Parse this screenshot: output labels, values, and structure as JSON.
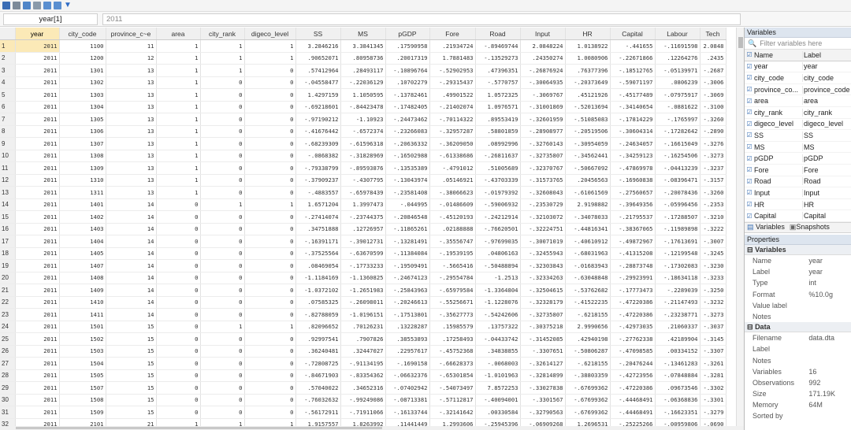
{
  "toolbar": {
    "icons": [
      "save-icon",
      "print-icon",
      "copy-icon",
      "paste-icon",
      "edit-icon",
      "browse-icon",
      "filter-icon"
    ]
  },
  "cellbar": {
    "name": "year[1]",
    "value": "2011"
  },
  "grid": {
    "columns": [
      "year",
      "city_code",
      "province_c~e",
      "area",
      "city_rank",
      "digeco_level",
      "SS",
      "MS",
      "pGDP",
      "Fore",
      "Road",
      "Input",
      "HR",
      "Capital",
      "Labour",
      "Tech"
    ],
    "rows": [
      [
        "1",
        "2011",
        "1100",
        "11",
        "1",
        "1",
        "1",
        "3.2846216",
        "3.3841345",
        ".17590958",
        ".21934724",
        "-.89469744",
        "2.0848224",
        "1.0138922",
        "-.441655",
        "-.11691598",
        "2.0848"
      ],
      [
        "2",
        "2011",
        "1200",
        "12",
        "1",
        "1",
        "1",
        ".90652071",
        ".80958736",
        ".20017319",
        "1.7881483",
        "-.13529273",
        ".24350274",
        "1.0080906",
        "-.22671866",
        ".12264276",
        ".2435"
      ],
      [
        "3",
        "2011",
        "1301",
        "13",
        "1",
        "1",
        "0",
        ".57412964",
        ".28493117",
        "-.10896764",
        "-.52902953",
        ".47396351",
        "-.26876924",
        ".76377396",
        "-.18512765",
        "-.05139971",
        "-.2687"
      ],
      [
        "4",
        "2011",
        "1302",
        "13",
        "1",
        "0",
        "0",
        "-.04558477",
        "-.22036129",
        ".10702279",
        "-.29315437",
        "-.5770757",
        "-.30064935",
        "-.20373649",
        "-.59071197",
        ".0806239",
        "-.3006"
      ],
      [
        "5",
        "2011",
        "1303",
        "13",
        "1",
        "0",
        "0",
        "1.4297159",
        "1.1050595",
        "-.13782461",
        ".49901522",
        "1.0572325",
        "-.3069767",
        ".45121926",
        "-.45177489",
        "-.07975917",
        "-.3069"
      ],
      [
        "6",
        "2011",
        "1304",
        "13",
        "1",
        "0",
        "0",
        "-.69218601",
        "-.84423478",
        "-.17482405",
        "-.21402074",
        "1.0976571",
        "-.31001869",
        "-.52013694",
        "-.34140654",
        "-.0881622",
        "-.3100"
      ],
      [
        "7",
        "2011",
        "1305",
        "13",
        "1",
        "0",
        "0",
        "-.97190212",
        "-1.10923",
        "-.24473462",
        "-.70114322",
        ".89553419",
        "-.32601959",
        "-.51085083",
        "-.17814229",
        "-.1765997",
        "-.3260"
      ],
      [
        "8",
        "2011",
        "1306",
        "13",
        "1",
        "0",
        "0",
        "-.41676442",
        "-.6572374",
        "-.23266083",
        "-.32957287",
        ".58801859",
        "-.28908977",
        "-.20519506",
        "-.30604314",
        "-.17282642",
        "-.2890"
      ],
      [
        "9",
        "2011",
        "1307",
        "13",
        "1",
        "0",
        "0",
        "-.68239309",
        "-.61596318",
        "-.20636332",
        "-.36209050",
        ".08992996",
        "-.32760143",
        "-.30954059",
        "-.24634057",
        "-.16615049",
        "-.3276"
      ],
      [
        "10",
        "2011",
        "1308",
        "13",
        "1",
        "0",
        "0",
        "-.0868382",
        "-.31828969",
        "-.16502988",
        "-.61338686",
        "-.26811637",
        "-.32735807",
        "-.34562441",
        "-.34259123",
        "-.16254506",
        "-.3273"
      ],
      [
        "11",
        "2011",
        "1309",
        "13",
        "1",
        "0",
        "0",
        "-.79338799",
        "-.89593876",
        "-.13535389",
        "-.4791012",
        ".51005689",
        "-.32370767",
        "-.50667092",
        "-.47869978",
        "-.04413239",
        "-.3237"
      ],
      [
        "12",
        "2011",
        "1310",
        "13",
        "1",
        "0",
        "0",
        "-.37909237",
        "-.4307795",
        "-.13043974",
        ".05146921",
        "-.43703339",
        "-.31573765",
        ".20456563",
        "-.16960838",
        "-.08396471",
        "-.3157"
      ],
      [
        "13",
        "2011",
        "1311",
        "13",
        "1",
        "0",
        "0",
        "-.4883557",
        "-.65978439",
        "-.23581408",
        "-.38066623",
        "-.01979392",
        "-.32608043",
        "-.61061569",
        "-.27560657",
        "-.20078436",
        "-.3260"
      ],
      [
        "14",
        "2011",
        "1401",
        "14",
        "0",
        "1",
        "1",
        "1.6571204",
        "1.3997473",
        "-.044995",
        "-.01486609",
        "-.59006932",
        "-.23530729",
        "2.9198882",
        "-.39649356",
        "-.05996456",
        "-.2353"
      ],
      [
        "15",
        "2011",
        "1402",
        "14",
        "0",
        "0",
        "0",
        "-.27414074",
        "-.23744375",
        "-.20846548",
        "-.45120193",
        "-.24212914",
        "-.32103072",
        "-.34078033",
        "-.21795537",
        "-.17288507",
        "-.3210"
      ],
      [
        "16",
        "2011",
        "1403",
        "14",
        "0",
        "0",
        "0",
        ".34751888",
        ".12726957",
        "-.11865261",
        ".02188888",
        "-.76620501",
        "-.32224751",
        "-.44816341",
        "-.38367065",
        "-.11989898",
        "-.3222"
      ],
      [
        "17",
        "2011",
        "1404",
        "14",
        "0",
        "0",
        "0",
        "-.16391171",
        "-.39012731",
        "-.13281491",
        "-.35556747",
        "-.97699035",
        "-.30071019",
        "-.40610912",
        "-.49872967",
        "-.17613691",
        "-.3007"
      ],
      [
        "18",
        "2011",
        "1405",
        "14",
        "0",
        "0",
        "0",
        "-.37525564",
        "-.63670599",
        "-.11384084",
        "-.19539195",
        ".04806163",
        "-.32455943",
        "-.68031963",
        "-.41315208",
        "-.12199548",
        "-.3245"
      ],
      [
        "19",
        "2011",
        "1407",
        "14",
        "0",
        "0",
        "0",
        ".08469054",
        "-.17733233",
        "-.19509491",
        "-.5665416",
        "-.50488894",
        "-.32303843",
        "-.01683943",
        "-.28873748",
        "-.17302083",
        "-.3230"
      ],
      [
        "20",
        "2011",
        "1408",
        "14",
        "0",
        "0",
        "0",
        "-1.1184169",
        "-1.1360825",
        "-.24674123",
        "-.29554784",
        "-1.2513",
        "-.32334263",
        "-.63048848",
        "-.29923991",
        "-.18634118",
        "-.3233"
      ],
      [
        "21",
        "2011",
        "1409",
        "14",
        "0",
        "0",
        "0",
        "-1.0372102",
        "-1.2651983",
        "-.25843963",
        "-.65979584",
        "-1.3364804",
        "-.32504615",
        "-.53762682",
        "-.17773473",
        "-.2289039",
        "-.3250"
      ],
      [
        "22",
        "2011",
        "1410",
        "14",
        "0",
        "0",
        "0",
        ".07585325",
        "-.26098011",
        "-.20246613",
        "-.55256671",
        "-1.1228076",
        "-.32328179",
        "-.41522235",
        "-.47220386",
        "-.21147493",
        "-.3232"
      ],
      [
        "23",
        "2011",
        "1411",
        "14",
        "0",
        "0",
        "0",
        "-.82788059",
        "-1.0196151",
        "-.17513801",
        "-.35627773",
        "-.54242606",
        "-.32735807",
        "-.6218155",
        "-.47220386",
        "-.23238771",
        "-.3273"
      ],
      [
        "24",
        "2011",
        "1501",
        "15",
        "0",
        "1",
        "1",
        ".82096652",
        ".70126231",
        ".13228287",
        ".15985579",
        ".13757322",
        "-.30375218",
        "2.9990656",
        "-.42973035",
        ".21060337",
        "-.3037"
      ],
      [
        "25",
        "2011",
        "1502",
        "15",
        "0",
        "0",
        "0",
        ".92997541",
        ".7907826",
        ".38553893",
        ".17258493",
        "-.04433742",
        "-.31452085",
        ".42940198",
        "-.27762338",
        ".42189904",
        "-.3145"
      ],
      [
        "26",
        "2011",
        "1503",
        "15",
        "0",
        "0",
        "0",
        ".36240481",
        ".32447027",
        ".22957617",
        "-.45752368",
        ".34838855",
        "-.3307651",
        "-.50806287",
        "-.47098585",
        ".00334152",
        "-.3307"
      ],
      [
        "27",
        "2011",
        "1504",
        "15",
        "0",
        "0",
        "0",
        "-.72808725",
        "-.91134195",
        "-.1690158",
        "-.66628373",
        "-.0068003",
        "-.32614127",
        "-.6218155",
        "-.20476244",
        "-.13461283",
        "-.3261"
      ],
      [
        "28",
        "2011",
        "1505",
        "15",
        "0",
        "0",
        "0",
        "-.84671903",
        "-.83354362",
        "-.06632376",
        "-.65301854",
        "-1.0101963",
        "-.32814899",
        "-.38803359",
        "-.42723956",
        "-.07848884",
        "-.3281"
      ],
      [
        "29",
        "2011",
        "1507",
        "15",
        "0",
        "0",
        "0",
        ".57040022",
        ".34652316",
        "-.07402942",
        "-.54073497",
        "7.8572253",
        "-.33027838",
        "-.67699362",
        "-.47220386",
        ".09673546",
        "-.3302"
      ],
      [
        "30",
        "2011",
        "1508",
        "15",
        "0",
        "0",
        "0",
        "-.76032632",
        "-.99249086",
        "-.08713381",
        "-.57112817",
        "-.40094001",
        "-.3301567",
        "-.67699362",
        "-.44468491",
        "-.06368836",
        "-.3301"
      ],
      [
        "31",
        "2011",
        "1509",
        "15",
        "0",
        "0",
        "0",
        "-.56172911",
        "-.71911066",
        "-.16133744",
        "-.32141642",
        ".00330584",
        "-.32790563",
        "-.67699362",
        "-.44468491",
        "-.16623351",
        "-.3279"
      ],
      [
        "32",
        "2011",
        "2101",
        "21",
        "1",
        "1",
        "1",
        "1.9157557",
        "1.8263992",
        ".11441449",
        "1.2993606",
        "-.25945396",
        "-.06909268",
        "1.2696531",
        "-.25225266",
        "-.00959806",
        "-.0690"
      ]
    ]
  },
  "variables": {
    "title": "Variables",
    "filter_placeholder": "Filter variables here",
    "col_name": "Name",
    "col_label": "Label",
    "items": [
      {
        "name": "year",
        "label": "year"
      },
      {
        "name": "city_code",
        "label": "city_code"
      },
      {
        "name": "province_co...",
        "label": "province_code"
      },
      {
        "name": "area",
        "label": "area"
      },
      {
        "name": "city_rank",
        "label": "city_rank"
      },
      {
        "name": "digeco_level",
        "label": "digeco_level"
      },
      {
        "name": "SS",
        "label": "SS"
      },
      {
        "name": "MS",
        "label": "MS"
      },
      {
        "name": "pGDP",
        "label": "pGDP"
      },
      {
        "name": "Fore",
        "label": "Fore"
      },
      {
        "name": "Road",
        "label": "Road"
      },
      {
        "name": "Input",
        "label": "Input"
      },
      {
        "name": "HR",
        "label": "HR"
      },
      {
        "name": "Capital",
        "label": "Capital"
      }
    ],
    "tab_variables": "Variables",
    "tab_snapshots": "Snapshots"
  },
  "properties": {
    "title": "Properties",
    "section_variables": "Variables",
    "var_props": [
      {
        "k": "Name",
        "v": "year"
      },
      {
        "k": "Label",
        "v": "year"
      },
      {
        "k": "Type",
        "v": "int"
      },
      {
        "k": "Format",
        "v": "%10.0g"
      },
      {
        "k": "Value label",
        "v": ""
      },
      {
        "k": "Notes",
        "v": ""
      }
    ],
    "section_data": "Data",
    "data_props": [
      {
        "k": "Filename",
        "v": "data.dta"
      },
      {
        "k": "Label",
        "v": ""
      },
      {
        "k": "Notes",
        "v": ""
      },
      {
        "k": "Variables",
        "v": "16"
      },
      {
        "k": "Observations",
        "v": "992"
      },
      {
        "k": "Size",
        "v": "171.19K"
      },
      {
        "k": "Memory",
        "v": "64M"
      },
      {
        "k": "Sorted by",
        "v": ""
      }
    ]
  }
}
